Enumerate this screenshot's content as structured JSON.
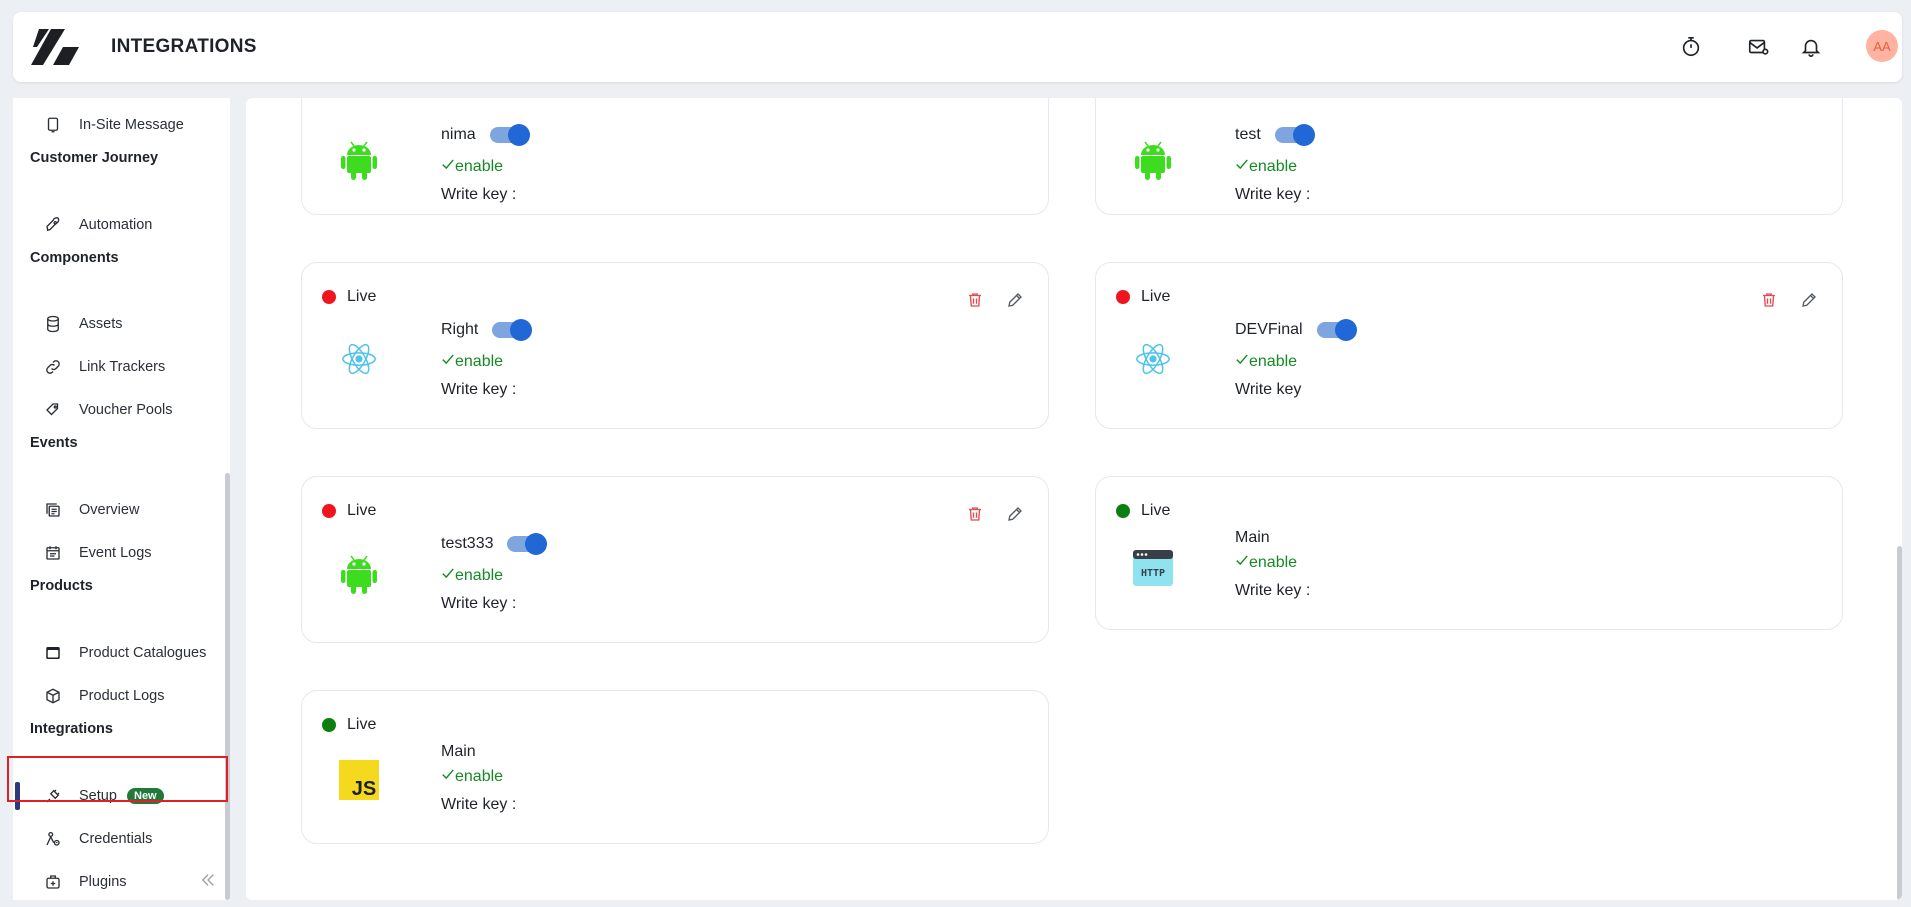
{
  "header": {
    "title": "INTEGRATIONS",
    "avatar_initials": "AA",
    "icons": [
      "timer-icon",
      "mail-icon",
      "bell-icon"
    ]
  },
  "sidebar": {
    "items": [
      {
        "type": "item",
        "label": "In-Site Message",
        "icon": "message-square-icon"
      },
      {
        "type": "section",
        "label": "Customer Journey"
      },
      {
        "type": "item",
        "label": "Automation",
        "icon": "rocket-icon"
      },
      {
        "type": "section",
        "label": "Components"
      },
      {
        "type": "item",
        "label": "Assets",
        "icon": "database-icon"
      },
      {
        "type": "item",
        "label": "Link Trackers",
        "icon": "link-icon"
      },
      {
        "type": "item",
        "label": "Voucher Pools",
        "icon": "ticket-icon"
      },
      {
        "type": "section",
        "label": "Events"
      },
      {
        "type": "item",
        "label": "Overview",
        "icon": "overview-icon"
      },
      {
        "type": "item",
        "label": "Event Logs",
        "icon": "calendar-list-icon"
      },
      {
        "type": "section",
        "label": "Products"
      },
      {
        "type": "item",
        "label": "Product Catalogues",
        "icon": "catalogue-icon"
      },
      {
        "type": "item",
        "label": "Product Logs",
        "icon": "box-icon"
      },
      {
        "type": "section",
        "label": "Integrations"
      },
      {
        "type": "item",
        "label": "Setup",
        "icon": "plug-icon",
        "badge": "New",
        "active": true
      },
      {
        "type": "item",
        "label": "Credentials",
        "icon": "credentials-icon"
      },
      {
        "type": "item",
        "label": "Plugins",
        "icon": "plugin-icon"
      }
    ]
  },
  "cards": [
    {
      "status": "",
      "status_color": "",
      "platform": "android-icon",
      "name": "nima",
      "toggle_on": true,
      "enable": "enable",
      "write_key": "Write key :",
      "actions": false
    },
    {
      "status": "",
      "status_color": "",
      "platform": "android-icon",
      "name": "test",
      "toggle_on": true,
      "enable": "enable",
      "write_key": "Write key :",
      "actions": false
    },
    {
      "status": "Live",
      "status_color": "#f0141e",
      "platform": "react-icon",
      "name": "Right",
      "toggle_on": true,
      "enable": "enable",
      "write_key": "Write key :",
      "actions": true
    },
    {
      "status": "Live",
      "status_color": "#f0141e",
      "platform": "react-icon",
      "name": "DEVFinal",
      "toggle_on": true,
      "enable": "enable",
      "write_key": "Write key",
      "actions": true
    },
    {
      "status": "Live",
      "status_color": "#f0141e",
      "platform": "android-icon",
      "name": "test333",
      "toggle_on": true,
      "enable": "enable",
      "write_key": "Write key :",
      "actions": true
    },
    {
      "status": "Live",
      "status_color": "#0c7f12",
      "platform": "http-icon",
      "name": "Main",
      "toggle_on": false,
      "enable": "enable",
      "write_key": "Write key :",
      "actions": false
    },
    {
      "status": "Live",
      "status_color": "#0c7f12",
      "platform": "javascript-icon",
      "name": "Main",
      "toggle_on": false,
      "enable": "enable",
      "write_key": "Write key :",
      "actions": false
    }
  ],
  "colors": {
    "accent": "#2167d6",
    "enable_green": "#158a23",
    "live_red": "#f0141e",
    "live_green": "#0c7f12",
    "highlight": "#e01f26"
  }
}
